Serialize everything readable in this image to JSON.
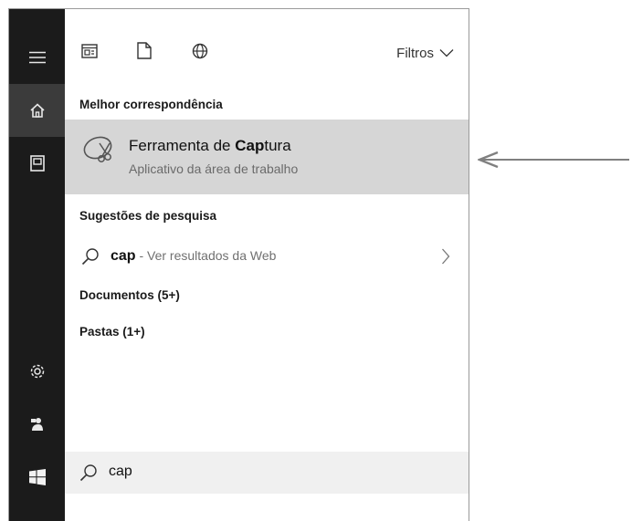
{
  "rail": {
    "items": [
      {
        "icon": "hamburger-menu-icon"
      },
      {
        "icon": "home-icon",
        "active": true
      },
      {
        "icon": "notebook-icon"
      },
      {
        "icon": "settings-gear-icon"
      },
      {
        "icon": "feedback-icon"
      },
      {
        "icon": "windows-start-icon"
      }
    ]
  },
  "topbar": {
    "icons": [
      "apps-icon",
      "documents-icon",
      "web-icon"
    ],
    "filters_label": "Filtros"
  },
  "best_match": {
    "heading": "Melhor correspondência",
    "title_prefix": "Ferramenta de ",
    "title_bold": "Cap",
    "title_suffix": "tura",
    "subtitle": "Aplicativo da área de trabalho",
    "icon": "snipping-tool-icon"
  },
  "search_suggestions": {
    "heading": "Sugestões de pesquisa",
    "query": "cap",
    "hint": " - Ver resultados da Web"
  },
  "documents": {
    "heading": "Documentos (5+)"
  },
  "folders": {
    "heading": "Pastas (1+)"
  },
  "search_box": {
    "value": "cap"
  },
  "colors": {
    "rail": "#1b1b1b",
    "highlight": "#d6d6d6",
    "search_box": "#f0f0f0",
    "arrow": "#808080"
  }
}
